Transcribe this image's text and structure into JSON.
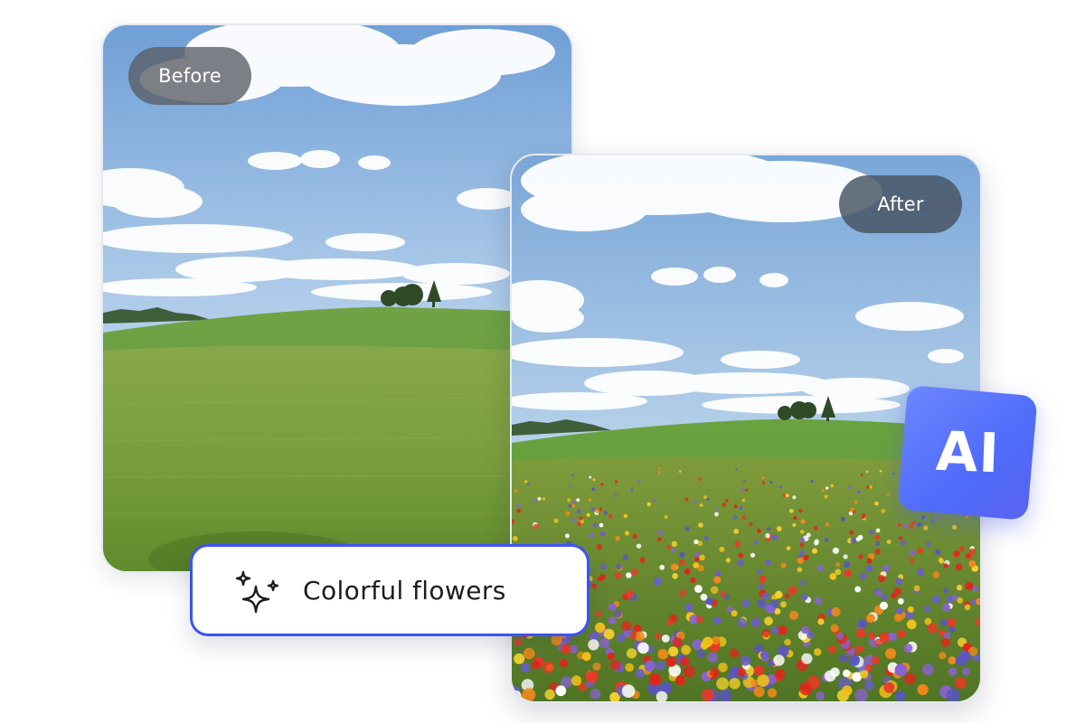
{
  "comparison": {
    "before": {
      "label": "Before"
    },
    "after": {
      "label": "After"
    }
  },
  "badge": {
    "text": "AI",
    "color": "#5b72fb"
  },
  "prompt": {
    "icon": "sparkles-icon",
    "text": "Colorful flowers",
    "border_color": "#3d52f5"
  }
}
